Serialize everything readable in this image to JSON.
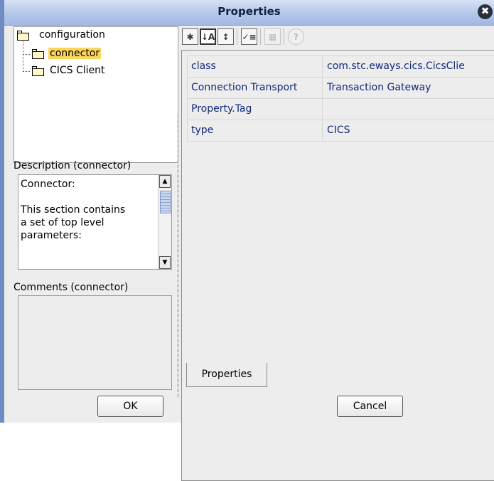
{
  "window": {
    "title": "Properties",
    "close_glyph": "✖"
  },
  "tree": {
    "root": "configuration",
    "children": [
      "connector",
      "CICS Client"
    ]
  },
  "description": {
    "label": "Description (connector)",
    "text": "Connector:\n\nThis section contains\na set of top level\nparameters:"
  },
  "comments": {
    "label": "Comments (connector)",
    "text": ""
  },
  "toolbar": {
    "buttons": [
      "categorized-icon",
      "alphabetical-icon",
      "filter-icon",
      "edit-list-icon",
      "grid-icon",
      "help-icon"
    ]
  },
  "properties": {
    "rows": [
      {
        "name": "class",
        "value": "com.stc.eways.cics.CicsClie"
      },
      {
        "name": "Connection Transport",
        "value": "Transaction Gateway"
      },
      {
        "name": "Property.Tag",
        "value": ""
      },
      {
        "name": "type",
        "value": "CICS"
      }
    ],
    "tab_label": "Properties"
  },
  "buttons": {
    "ok": "OK",
    "cancel": "Cancel"
  },
  "colors": {
    "titlebar": "#b3c7ea",
    "selection": "#fbd65c",
    "value_text": "#102a7a"
  }
}
